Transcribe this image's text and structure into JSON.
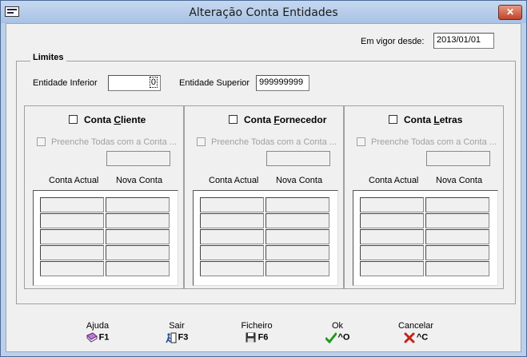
{
  "window": {
    "title": "Alteração Conta Entidades"
  },
  "header": {
    "vigor_label": "Em vigor desde:",
    "vigor_value": "2013/01/01"
  },
  "limites": {
    "title": "Limites",
    "inferior_label": "Entidade Inferior",
    "inferior_value": "0",
    "superior_label": "Entidade Superior",
    "superior_value": "999999999"
  },
  "panels": [
    {
      "title": "Conta Cliente",
      "underline": "C",
      "prefix": "Conta ",
      "rest": "liente",
      "fill_label": "Preenche Todas com a Conta ...",
      "col_actual": "Conta Actual",
      "col_nova": "Nova Conta"
    },
    {
      "title": "Conta Fornecedor",
      "underline": "F",
      "prefix": "Conta ",
      "rest": "ornecedor",
      "fill_label": "Preenche Todas com a Conta ...",
      "col_actual": "Conta Actual",
      "col_nova": "Nova Conta"
    },
    {
      "title": "Conta Letras",
      "underline": "L",
      "prefix": "Conta ",
      "rest": "etras",
      "fill_label": "Preenche Todas com a Conta ...",
      "col_actual": "Conta Actual",
      "col_nova": "Nova Conta"
    }
  ],
  "footer": {
    "ajuda": {
      "label": "Ajuda",
      "key": "F1",
      "icon": "book-icon"
    },
    "sair": {
      "label": "Sair",
      "key": "F3",
      "icon": "exit-door-icon"
    },
    "ficheiro": {
      "label": "Ficheiro",
      "key": "F6",
      "icon": "floppy-disk-icon"
    },
    "ok": {
      "label": "Ok",
      "key": "^O",
      "icon": "checkmark-icon"
    },
    "cancelar": {
      "label": "Cancelar",
      "key": "^C",
      "icon": "x-cross-icon"
    }
  }
}
